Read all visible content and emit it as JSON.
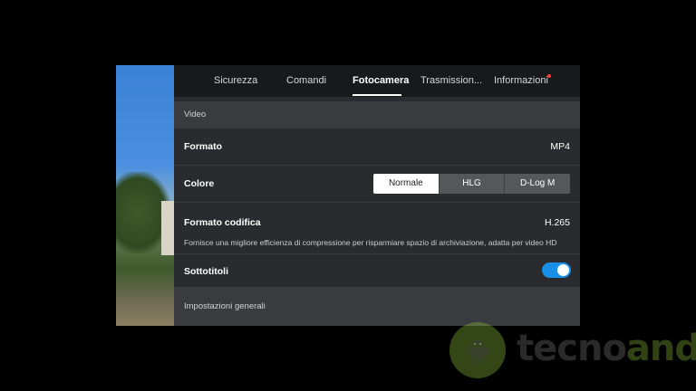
{
  "tabs": [
    {
      "label": "Sicurezza",
      "active": false
    },
    {
      "label": "Comandi",
      "active": false
    },
    {
      "label": "Fotocamera",
      "active": true
    },
    {
      "label": "Trasmission...",
      "active": false
    },
    {
      "label": "Informazioni",
      "active": false,
      "badge": "red-dot"
    }
  ],
  "video_section": {
    "title": "Video"
  },
  "formato": {
    "label": "Formato",
    "value": "MP4"
  },
  "colore": {
    "label": "Colore",
    "options": [
      "Normale",
      "HLG",
      "D-Log M"
    ],
    "selected": "Normale"
  },
  "formato_codifica": {
    "label": "Formato codifica",
    "value": "H.265",
    "description": "Fornisce una migliore efficienza di compressione per risparmiare spazio di archiviazione, adatta per video HD"
  },
  "sottotitoli": {
    "label": "Sottotitoli",
    "enabled": true
  },
  "general_section": {
    "title": "Impostazioni generali"
  },
  "watermark": {
    "part1": "tecno",
    "part2": "android"
  },
  "colors": {
    "accent": "#1a8fe8",
    "badge": "#ff3b30",
    "panel": "#2a2b2e",
    "tabbar": "#18191b"
  }
}
